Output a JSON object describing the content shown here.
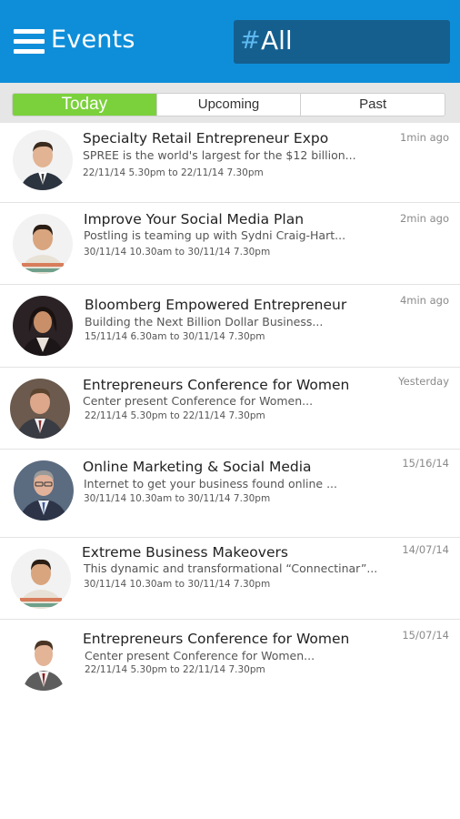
{
  "header": {
    "title": "Events",
    "filter_hash": "#",
    "filter_value": "All"
  },
  "tabs": [
    {
      "label": "Today",
      "active": true
    },
    {
      "label": "Upcoming",
      "active": false
    },
    {
      "label": "Past",
      "active": false
    }
  ],
  "events": [
    {
      "title": "Specialty Retail Entrepreneur Expo",
      "description": "SPREE is the world's largest  for the $12 billion...",
      "date_range": "22/11/14 5.30pm  to  22/11/14  7.30pm",
      "time": "1min ago"
    },
    {
      "title": "Improve Your Social Media Plan",
      "description": "Postling is teaming up with Sydni Craig-Hart...",
      "date_range": "30/11/14 10.30am  to  30/11/14  7.30pm",
      "time": "2min ago"
    },
    {
      "title": "Bloomberg Empowered Entrepreneur",
      "description": "Building the Next Billion Dollar Business...",
      "date_range": "15/11/14 6.30am  to  30/11/14  7.30pm",
      "time": "4min ago"
    },
    {
      "title": "Entrepreneurs Conference for Women",
      "description": "Center present Conference for Women...",
      "date_range": "22/11/14 5.30pm  to  22/11/14  7.30pm",
      "time": "Yesterday"
    },
    {
      "title": "Online Marketing & Social Media",
      "description": "Internet to get your business found online ...",
      "date_range": "30/11/14 10.30am  to  30/11/14  7.30pm",
      "time": "15/16/14"
    },
    {
      "title": "Extreme Business Makeovers",
      "description": "This dynamic and transformational “Connectinar”...",
      "date_range": "30/11/14 10.30am  to  30/11/14  7.30pm",
      "time": "14/07/14"
    },
    {
      "title": "Entrepreneurs Conference for Women",
      "description": "Center present Conference for Women...",
      "date_range": "22/11/14 5.30pm  to  22/11/14  7.30pm",
      "time": "15/07/14"
    }
  ],
  "colors": {
    "header_bg": "#0e8ed9",
    "filter_bg": "#155f8f",
    "active_tab": "#7bd13b"
  }
}
